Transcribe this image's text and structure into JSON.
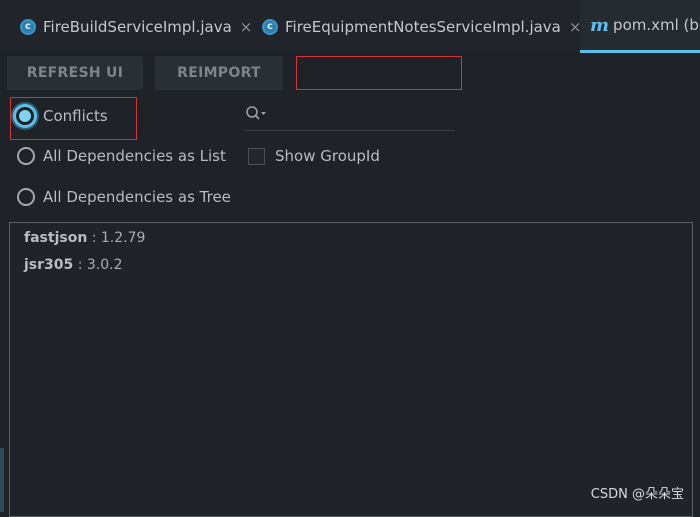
{
  "tabs": [
    {
      "label": "FireBuildServiceImpl.java",
      "icon": "java-class-icon",
      "close": "×"
    },
    {
      "label": "FireEquipmentNotesServiceImpl.java",
      "icon": "java-class-icon",
      "close": "×"
    },
    {
      "label": "pom.xml (bl",
      "icon": "maven-icon",
      "active": true
    }
  ],
  "toolbar": {
    "refresh_label": "REFRESH UI",
    "reimport_label": "REIMPORT"
  },
  "options": {
    "conflicts": "Conflicts",
    "all_list": "All Dependencies as List",
    "all_tree": "All Dependencies as Tree",
    "show_groupid": "Show GroupId",
    "selected": "Conflicts"
  },
  "search": {
    "placeholder": ""
  },
  "dependencies": [
    {
      "name": "fastjson",
      "version": " : 1.2.79"
    },
    {
      "name": "jsr305",
      "version": " : 3.0.2"
    }
  ],
  "watermark": "CSDN @朵朵宝",
  "colors": {
    "accent": "#5ec0e8",
    "highlight_border": "#d3343b",
    "background": "#1f2227"
  }
}
